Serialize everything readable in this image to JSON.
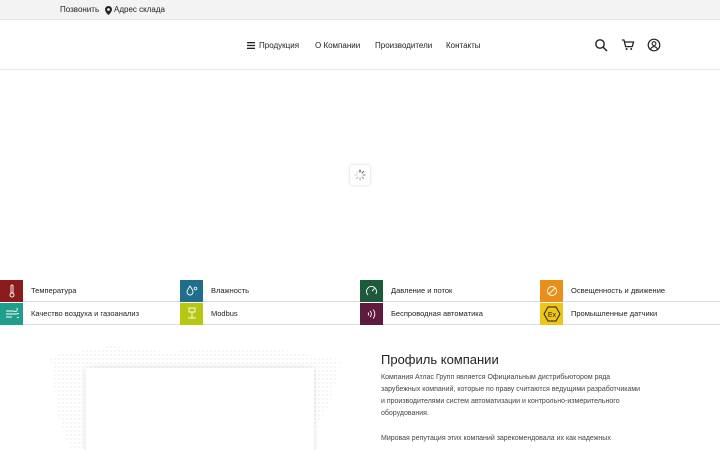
{
  "topbar": {
    "phone_label": "Позвонить",
    "address_label": "Адрес склада"
  },
  "nav": {
    "products": "Продукция",
    "about": "О Компании",
    "manufacturers": "Производители",
    "contacts": "Контакты"
  },
  "categories": [
    {
      "label": "Температура",
      "icon": "thermometer-icon",
      "color": "#8b1c1c"
    },
    {
      "label": "Влажность",
      "icon": "humidity-icon",
      "color": "#1f6e8c"
    },
    {
      "label": "Давление и поток",
      "icon": "pressure-gauge-icon",
      "color": "#1c5a3a"
    },
    {
      "label": "Освещенность и движение",
      "icon": "light-icon",
      "color": "#e8901a"
    },
    {
      "label": "Качество воздуха и газоанализ",
      "icon": "air-quality-icon",
      "color": "#1e9e8c"
    },
    {
      "label": "Modbus",
      "icon": "modbus-icon",
      "color": "#b6c814"
    },
    {
      "label": "Беспроводная автоматика",
      "icon": "wireless-icon",
      "color": "#5e1b3e"
    },
    {
      "label": "Промышленные датчики",
      "icon": "ex-icon",
      "color": "#f0c419"
    }
  ],
  "profile": {
    "title": "Профиль компании",
    "paragraph1": "Компания Атлас Групп является Официальным дистрибьютором ряда зарубежных компаний, которые по праву считаются ведущими разработчиками и производителями систем автоматизации и контрольно-измерительного оборудования.",
    "paragraph2": "Мировая репутация этих компаний зарекомендовала их как надежных"
  }
}
